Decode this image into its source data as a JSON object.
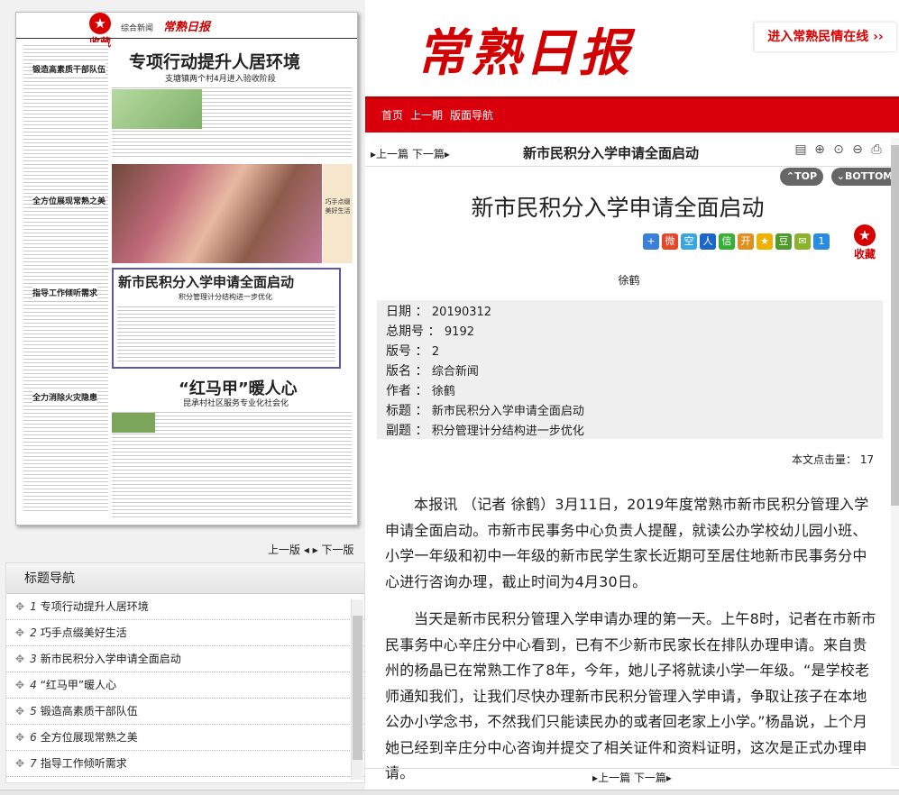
{
  "paper": {
    "fav_label": "收藏",
    "section_label": "综合新闻",
    "masthead": "常熟日报",
    "headline1": "专项行动提升人居环境",
    "headline1_sub": "支塘镇两个村4月进入验收阶段",
    "side1_title": "锻造高素质干部队伍",
    "side2_title": "全方位展现常熟之美",
    "side3_title": "指导工作倾听需求",
    "side4_title": "全力消除火灾隐患",
    "photo_caption": "巧手点缀美好生活",
    "box_title": "新市民积分入学申请全面启动",
    "box_sub": "积分管理计分结构进一步优化",
    "headline2": "“红马甲”暖人心",
    "headline2_sub": "昆承村社区服务专业化社会化"
  },
  "left_pager": {
    "prev": "上一版",
    "next": "下一版"
  },
  "nav": {
    "title": "标题导航",
    "items": [
      {
        "num": "1",
        "label": "专项行动提升人居环境"
      },
      {
        "num": "2",
        "label": "巧手点缀美好生活"
      },
      {
        "num": "3",
        "label": "新市民积分入学申请全面启动"
      },
      {
        "num": "4",
        "label": "“红马甲”暖人心"
      },
      {
        "num": "5",
        "label": "锻造高素质干部队伍"
      },
      {
        "num": "6",
        "label": "全方位展现常熟之美"
      },
      {
        "num": "7",
        "label": "指导工作倾听需求"
      }
    ]
  },
  "site": {
    "logo": "常熟日报",
    "minqing_link": "进入常熟民情在线",
    "menu": [
      "首页",
      "上一期",
      "版面导航"
    ]
  },
  "titlebar": {
    "prev": "上一篇",
    "next": "下一篇",
    "title": "新市民积分入学申请全面启动"
  },
  "top_label": "TOP",
  "bottom_label": "BOTTOM",
  "article": {
    "title": "新市民积分入学申请全面启动",
    "fav_label": "收藏",
    "author": "徐鹤",
    "meta": [
      {
        "key": "日期",
        "value": "20190312"
      },
      {
        "key": "总期号",
        "value": "9192"
      },
      {
        "key": "版号",
        "value": "2"
      },
      {
        "key": "版名",
        "value": "综合新闻"
      },
      {
        "key": "作者",
        "value": "徐鹤"
      },
      {
        "key": "标题",
        "value": "新市民积分入学申请全面启动"
      },
      {
        "key": "副题",
        "value": "积分管理计分结构进一步优化"
      }
    ],
    "hits_label": "本文点击量：",
    "hits": "17",
    "paragraphs": [
      "本报讯 （记者 徐鹤）3月11日，2019年度常熟市新市民积分管理入学申请全面启动。市新市民事务中心负责人提醒，就读公办学校幼儿园小班、小学一年级和初中一年级的新市民学生家长近期可至居住地新市民事务分中心进行咨询办理，截止时间为4月30日。",
      "当天是新市民积分管理入学申请办理的第一天。上午8时，记者在市新市民事务中心辛庄分中心看到，已有不少新市民家长在排队办理申请。来自贵州的杨晶已在常熟工作了8年，今年，她儿子将就读小学一年级。“是学校老师通知我们，让我们尽快办理新市民积分管理入学申请，争取让孩子在本地公办小学念书，不然我们只能读民办的或者回老家上小学。”杨晶说，上个月她已经到辛庄分中心咨询并提交了相关证件和资料证明，这次是正式办理申请。"
    ]
  },
  "bottom_pager": {
    "prev": "上一篇",
    "next": "下一篇"
  },
  "colors": {
    "brand_red": "#d9000c",
    "logo_red": "#d20000"
  }
}
